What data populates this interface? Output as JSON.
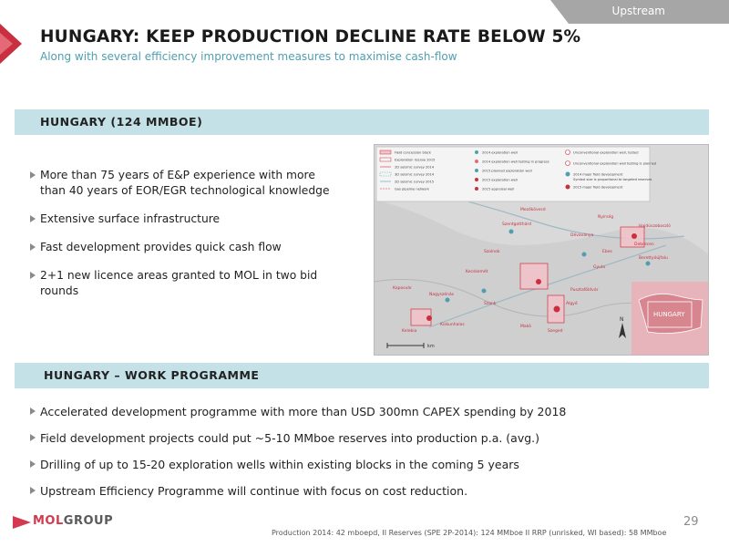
{
  "tab": {
    "label": "Upstream"
  },
  "header": {
    "title": "HUNGARY: KEEP PRODUCTION DECLINE RATE BELOW 5%",
    "subtitle": "Along with several efficiency improvement measures to maximise cash-flow"
  },
  "section1": {
    "heading": "HUNGARY (124 MMBOE)",
    "bullets": [
      {
        "line1": "More than 75 years of E&P experience with more",
        "line2": "than 40 years of EOR/EGR technological knowledge"
      },
      {
        "line1": "Extensive surface infrastructure",
        "line2": ""
      },
      {
        "line1": "Fast development provides quick cash flow",
        "line2": ""
      },
      {
        "line1": "2+1 new licence areas granted to MOL in two bid",
        "line2": "rounds"
      }
    ]
  },
  "map": {
    "inset_label": "HUNGARY",
    "scale_label": "km",
    "north_label": "N",
    "legend_left": [
      "Field concession block",
      "Exploration license 2015",
      "2D seismic survey 2014",
      "3D seismic survey 2014",
      "2D seismic survey 2015",
      "Gas pipeline network"
    ],
    "legend_mid": [
      "2014 exploration well",
      "2014 exploration well testing in progress",
      "2015 planned exploration well",
      "2015 exploration well",
      "2015 appraisal well"
    ],
    "legend_right": [
      "Unconventional exploration well, tested",
      "Unconventional exploration well testing is planned",
      "2014 major field development",
      "Symbol size is proportional to targeted reserves",
      "2015 major field development"
    ],
    "places": [
      "Szentgotthárd",
      "Nagyszénás",
      "Kaposvár",
      "Kiskunhalas",
      "Gyula",
      "Szolnok",
      "Debrecen",
      "Ebes",
      "Berettyóújfalu",
      "Makó",
      "Szeged",
      "Szank",
      "Algyő",
      "Kecskemét",
      "Pusztaföldvár",
      "Dévaványa",
      "Mezőkövesd",
      "Nyírség",
      "Hajdúszoboszló",
      "Kelebia"
    ]
  },
  "section2": {
    "heading": "HUNGARY – WORK PROGRAMME",
    "bullets": [
      "Accelerated development programme with more than USD 300mn CAPEX spending by 2018",
      "Field development projects could put ~5-10 MMboe reserves into production p.a. (avg.)",
      "Drilling of up to 15-20 exploration wells within existing blocks in the coming 5 years",
      "Upstream Efficiency Programme will continue with focus on cost reduction."
    ]
  },
  "footer": {
    "logo_part1": "MOL",
    "logo_part2": "GROUP",
    "note": "Production 2014: 42 mboepd, II  Reserves (SPE 2P-2014): 124 MMboe II RRP (unrisked, WI based): 58 MMboe",
    "page_number": "29"
  },
  "colors": {
    "accent_red": "#d43a4f",
    "band_teal": "#c3e1e6",
    "subtitle_teal": "#4f9fb0",
    "tab_gray": "#a6a6a6"
  }
}
